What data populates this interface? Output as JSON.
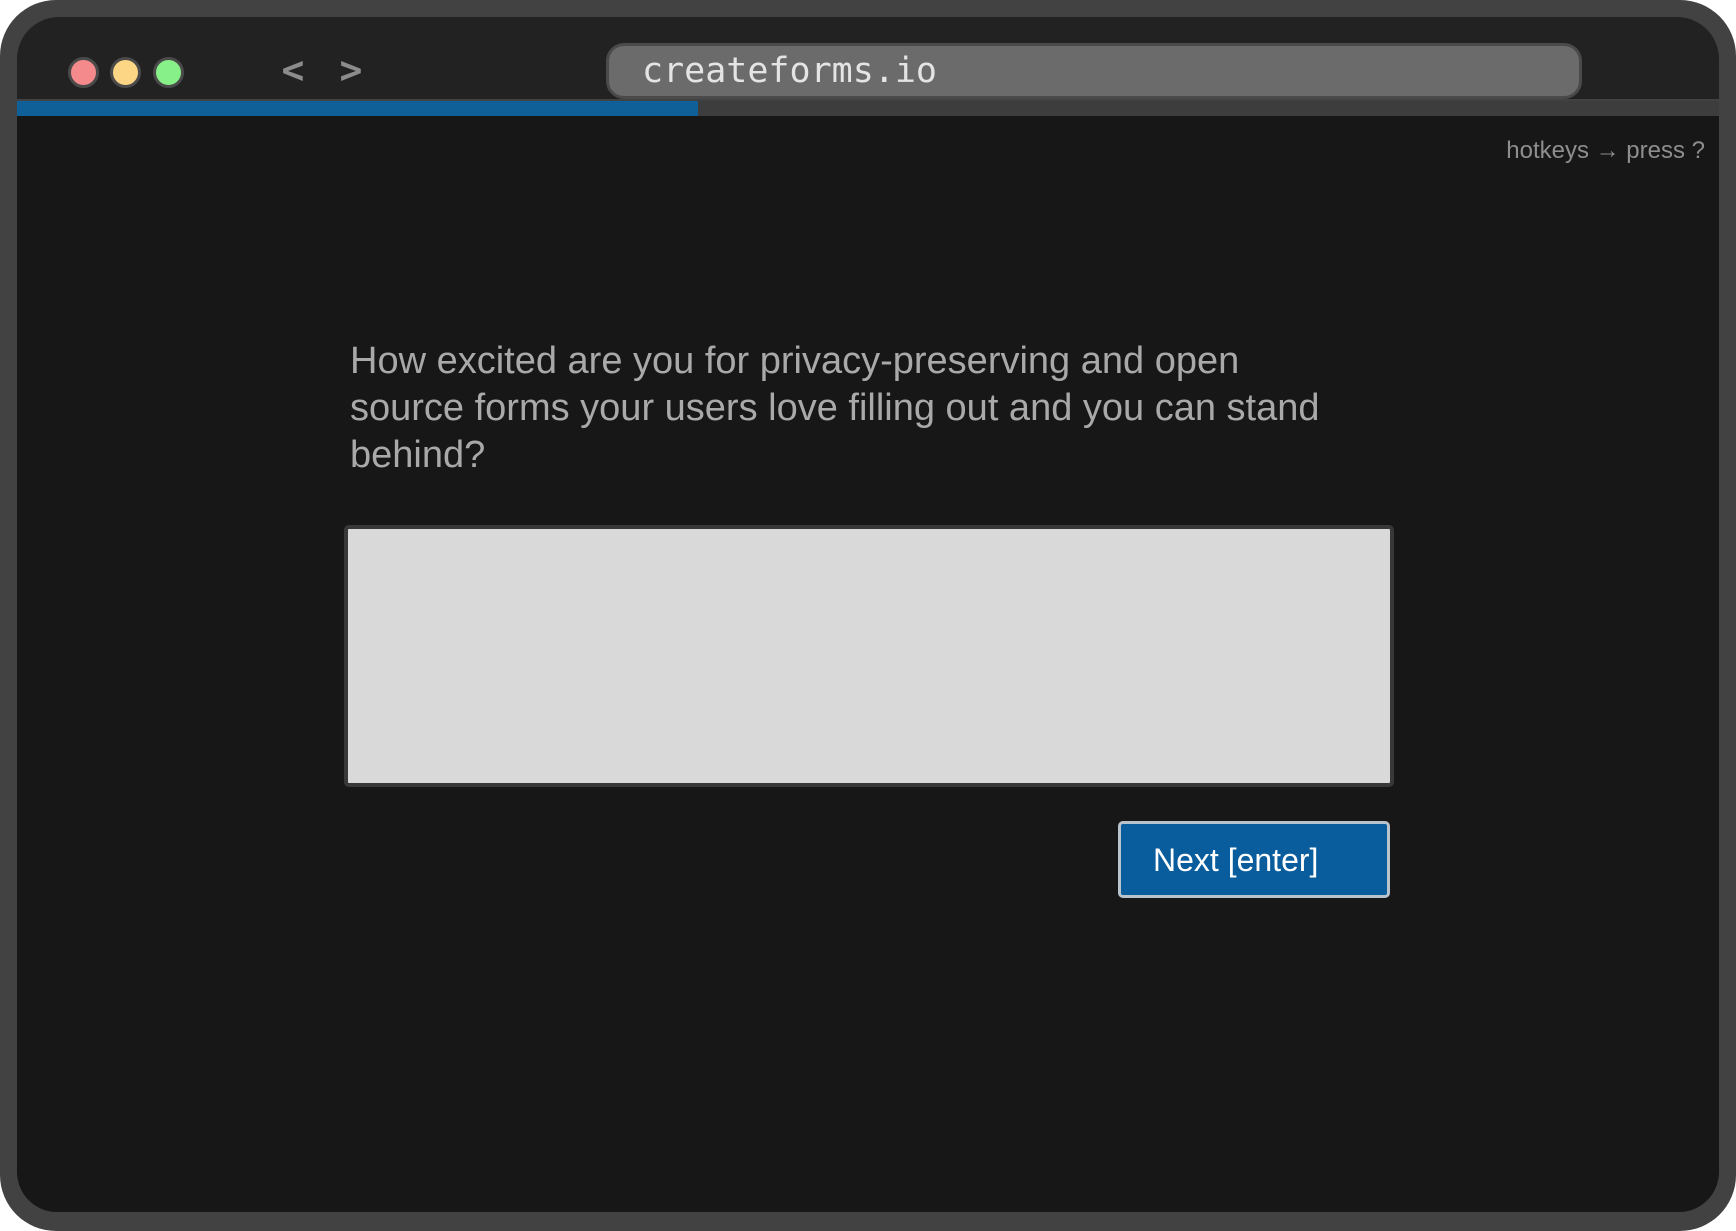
{
  "browser": {
    "url": "createforms.io",
    "back_label": "<",
    "forward_label": ">"
  },
  "progress": {
    "fraction": 0.4
  },
  "form": {
    "hotkeys_hint": "hotkeys → press ?",
    "question": "How excited are you for privacy-preserving and open source forms your users love filling out and you can stand behind?",
    "answer_value": "",
    "next_label": "Next [enter]"
  },
  "colors": {
    "accent": "#0a5d9c",
    "progress": "#0f5f99",
    "page_background": "#171717",
    "frame": "#424242"
  }
}
